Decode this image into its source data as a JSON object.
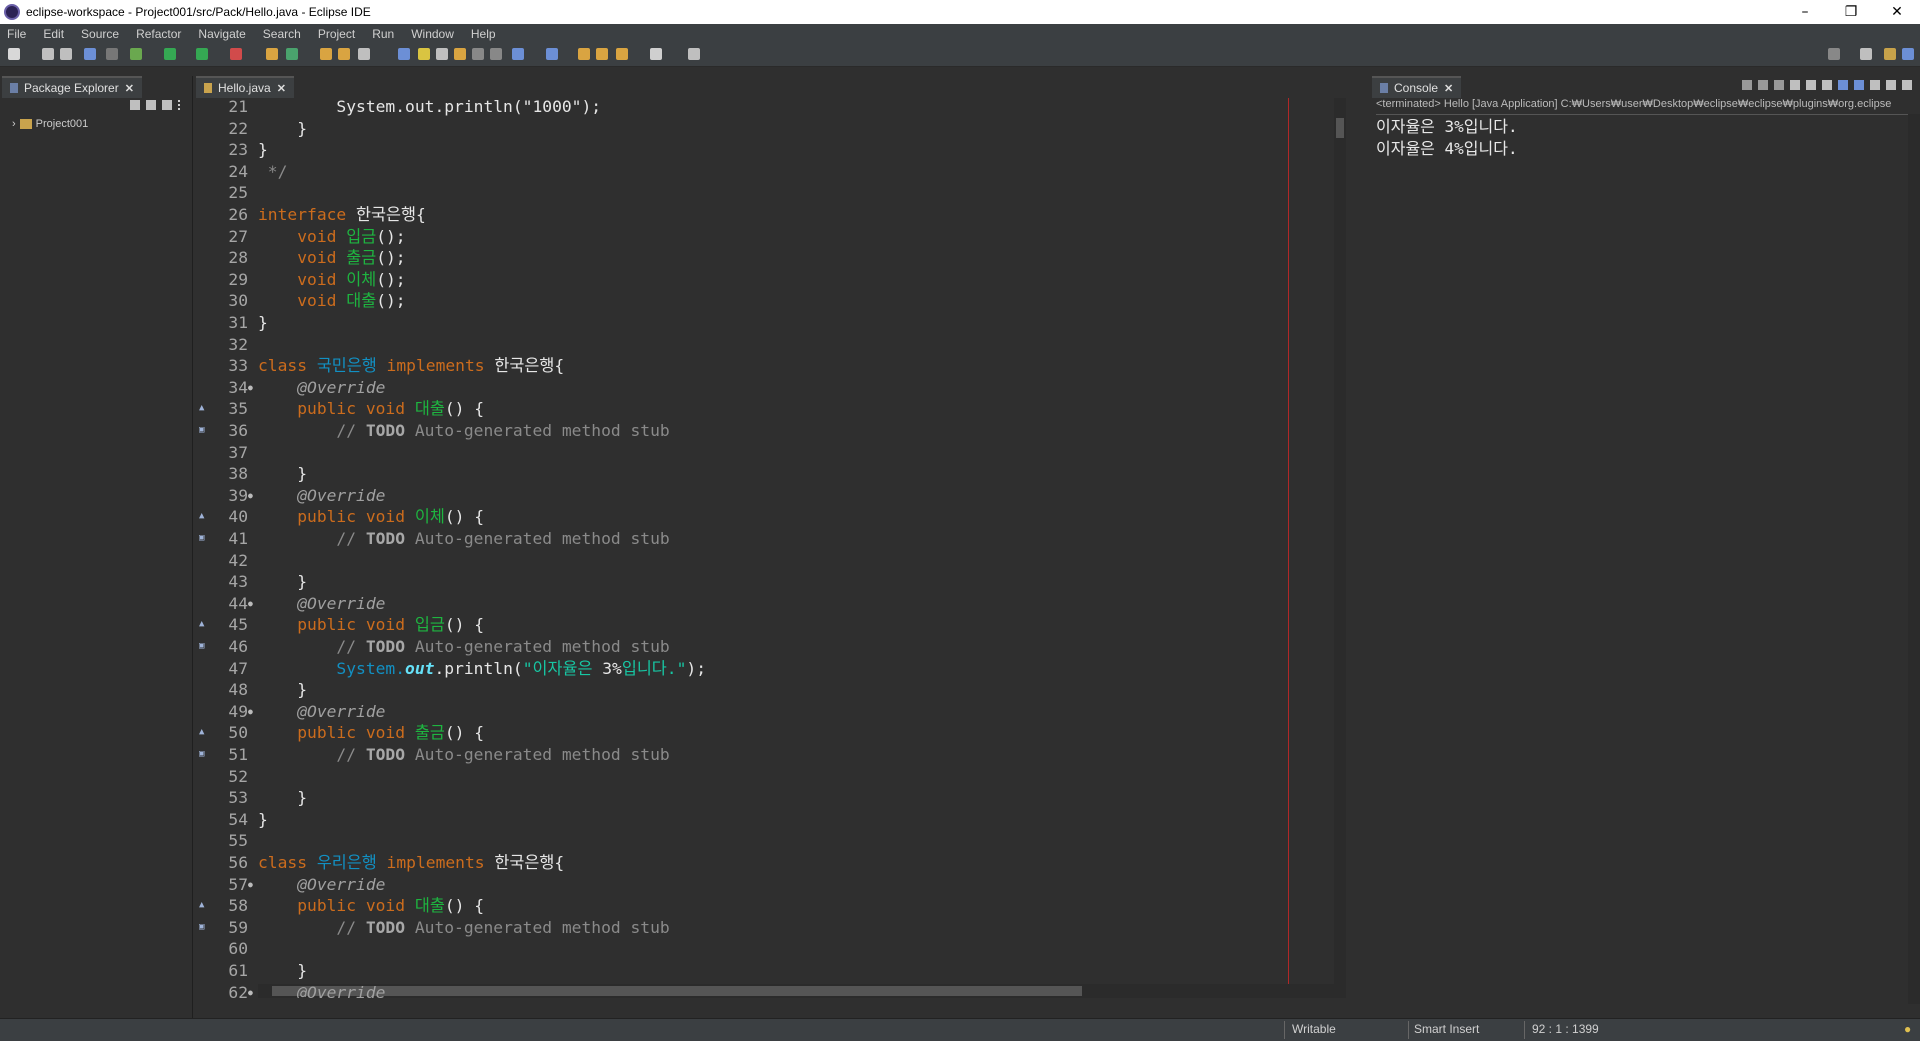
{
  "window": {
    "title": "eclipse-workspace - Project001/src/Pack/Hello.java - Eclipse IDE",
    "minimize": "–",
    "restore": "❐",
    "close": "✕"
  },
  "menu": [
    "File",
    "Edit",
    "Source",
    "Refactor",
    "Navigate",
    "Search",
    "Project",
    "Run",
    "Window",
    "Help"
  ],
  "package_explorer": {
    "tab_label": "Package Explorer",
    "close": "✕",
    "items": [
      {
        "label": "Project001",
        "expander": "›"
      }
    ]
  },
  "editor": {
    "tab_label": "Hello.java",
    "close": "✕",
    "lines": [
      {
        "n": "21",
        "tokens": [
          {
            "t": "        ",
            "c": "pl"
          },
          {
            "t": "System.out.println(\"1000\");",
            "c": "pl"
          }
        ]
      },
      {
        "n": "22",
        "tokens": [
          {
            "t": "    }",
            "c": "pl"
          }
        ]
      },
      {
        "n": "23",
        "tokens": [
          {
            "t": "}",
            "c": "pl"
          }
        ]
      },
      {
        "n": "24",
        "tokens": [
          {
            "t": " */",
            "c": "cm"
          }
        ]
      },
      {
        "n": "25",
        "tokens": []
      },
      {
        "n": "26",
        "tokens": [
          {
            "t": "interface ",
            "c": "kw"
          },
          {
            "t": "한국은행",
            "c": "pl"
          },
          {
            "t": "{",
            "c": "pl"
          }
        ]
      },
      {
        "n": "27",
        "tokens": [
          {
            "t": "    void ",
            "c": "kw"
          },
          {
            "t": "입금",
            "c": "mth"
          },
          {
            "t": "();",
            "c": "pl"
          }
        ]
      },
      {
        "n": "28",
        "tokens": [
          {
            "t": "    void ",
            "c": "kw"
          },
          {
            "t": "출금",
            "c": "mth"
          },
          {
            "t": "();",
            "c": "pl"
          }
        ]
      },
      {
        "n": "29",
        "tokens": [
          {
            "t": "    void ",
            "c": "kw"
          },
          {
            "t": "이체",
            "c": "mth"
          },
          {
            "t": "();",
            "c": "pl"
          }
        ]
      },
      {
        "n": "30",
        "tokens": [
          {
            "t": "    void ",
            "c": "kw"
          },
          {
            "t": "대출",
            "c": "mth"
          },
          {
            "t": "();",
            "c": "pl"
          }
        ]
      },
      {
        "n": "31",
        "tokens": [
          {
            "t": "}",
            "c": "pl"
          }
        ]
      },
      {
        "n": "32",
        "tokens": []
      },
      {
        "n": "33",
        "tokens": [
          {
            "t": "class ",
            "c": "kw"
          },
          {
            "t": "국민은행",
            "c": "cls"
          },
          {
            "t": " implements ",
            "c": "kw"
          },
          {
            "t": "한국은행",
            "c": "pl"
          },
          {
            "t": "{",
            "c": "pl"
          }
        ]
      },
      {
        "n": "34",
        "fold": "●",
        "tokens": [
          {
            "t": "    @Override",
            "c": "an"
          }
        ]
      },
      {
        "n": "35",
        "marker": "▲",
        "tokens": [
          {
            "t": "    public void ",
            "c": "kw"
          },
          {
            "t": "대출",
            "c": "mth"
          },
          {
            "t": "() {",
            "c": "pl"
          }
        ]
      },
      {
        "n": "36",
        "marker": "▣",
        "tokens": [
          {
            "t": "        // ",
            "c": "cm"
          },
          {
            "t": "TODO",
            "c": "todo"
          },
          {
            "t": " Auto-generated method stub",
            "c": "cm"
          }
        ]
      },
      {
        "n": "37",
        "tokens": []
      },
      {
        "n": "38",
        "tokens": [
          {
            "t": "    }",
            "c": "pl"
          }
        ]
      },
      {
        "n": "39",
        "fold": "●",
        "tokens": [
          {
            "t": "    @Override",
            "c": "an"
          }
        ]
      },
      {
        "n": "40",
        "marker": "▲",
        "tokens": [
          {
            "t": "    public void ",
            "c": "kw"
          },
          {
            "t": "이체",
            "c": "mth"
          },
          {
            "t": "() {",
            "c": "pl"
          }
        ]
      },
      {
        "n": "41",
        "marker": "▣",
        "tokens": [
          {
            "t": "        // ",
            "c": "cm"
          },
          {
            "t": "TODO",
            "c": "todo"
          },
          {
            "t": " Auto-generated method stub",
            "c": "cm"
          }
        ]
      },
      {
        "n": "42",
        "tokens": []
      },
      {
        "n": "43",
        "tokens": [
          {
            "t": "    }",
            "c": "pl"
          }
        ]
      },
      {
        "n": "44",
        "fold": "●",
        "tokens": [
          {
            "t": "    @Override",
            "c": "an"
          }
        ]
      },
      {
        "n": "45",
        "marker": "▲",
        "tokens": [
          {
            "t": "    public void ",
            "c": "kw"
          },
          {
            "t": "입금",
            "c": "mth"
          },
          {
            "t": "() {",
            "c": "pl"
          }
        ]
      },
      {
        "n": "46",
        "marker": "▣",
        "tokens": [
          {
            "t": "        // ",
            "c": "cm"
          },
          {
            "t": "TODO",
            "c": "todo"
          },
          {
            "t": " Auto-generated method stub",
            "c": "cm"
          }
        ]
      },
      {
        "n": "47",
        "tokens": [
          {
            "t": "        System.",
            "c": "cls"
          },
          {
            "t": "out",
            "c": "fld"
          },
          {
            "t": ".println(",
            "c": "pl"
          },
          {
            "t": "\"이자율은 ",
            "c": "str"
          },
          {
            "t": "3%",
            "c": "pl"
          },
          {
            "t": "입니다.\"",
            "c": "str"
          },
          {
            "t": ");",
            "c": "pl"
          }
        ]
      },
      {
        "n": "48",
        "tokens": [
          {
            "t": "    }",
            "c": "pl"
          }
        ]
      },
      {
        "n": "49",
        "fold": "●",
        "tokens": [
          {
            "t": "    @Override",
            "c": "an"
          }
        ]
      },
      {
        "n": "50",
        "marker": "▲",
        "tokens": [
          {
            "t": "    public void ",
            "c": "kw"
          },
          {
            "t": "출금",
            "c": "mth"
          },
          {
            "t": "() {",
            "c": "pl"
          }
        ]
      },
      {
        "n": "51",
        "marker": "▣",
        "tokens": [
          {
            "t": "        // ",
            "c": "cm"
          },
          {
            "t": "TODO",
            "c": "todo"
          },
          {
            "t": " Auto-generated method stub",
            "c": "cm"
          }
        ]
      },
      {
        "n": "52",
        "tokens": []
      },
      {
        "n": "53",
        "tokens": [
          {
            "t": "    }",
            "c": "pl"
          }
        ]
      },
      {
        "n": "54",
        "tokens": [
          {
            "t": "}",
            "c": "pl"
          }
        ]
      },
      {
        "n": "55",
        "tokens": []
      },
      {
        "n": "56",
        "tokens": [
          {
            "t": "class ",
            "c": "kw"
          },
          {
            "t": "우리은행",
            "c": "cls"
          },
          {
            "t": " implements ",
            "c": "kw"
          },
          {
            "t": "한국은행",
            "c": "pl"
          },
          {
            "t": "{",
            "c": "pl"
          }
        ]
      },
      {
        "n": "57",
        "fold": "●",
        "tokens": [
          {
            "t": "    @Override",
            "c": "an"
          }
        ]
      },
      {
        "n": "58",
        "marker": "▲",
        "tokens": [
          {
            "t": "    public void ",
            "c": "kw"
          },
          {
            "t": "대출",
            "c": "mth"
          },
          {
            "t": "() {",
            "c": "pl"
          }
        ]
      },
      {
        "n": "59",
        "marker": "▣",
        "tokens": [
          {
            "t": "        // ",
            "c": "cm"
          },
          {
            "t": "TODO",
            "c": "todo"
          },
          {
            "t": " Auto-generated method stub",
            "c": "cm"
          }
        ]
      },
      {
        "n": "60",
        "tokens": []
      },
      {
        "n": "61",
        "tokens": [
          {
            "t": "    }",
            "c": "pl"
          }
        ]
      },
      {
        "n": "62",
        "fold": "●",
        "tokens": [
          {
            "t": "    @Override",
            "c": "an"
          }
        ]
      }
    ]
  },
  "console": {
    "tab_label": "Console",
    "close": "✕",
    "path": "<terminated> Hello [Java Application] C:₩Users₩user₩Desktop₩eclipse₩eclipse₩plugins₩org.eclipse",
    "output": [
      "이자율은 3%입니다.",
      "이자율은 4%입니다."
    ]
  },
  "status": {
    "writable": "Writable",
    "insert_mode": "Smart Insert",
    "position": "92 : 1 : 1399"
  },
  "colors": {
    "keyword": "#cc6c1d",
    "method": "#1eb540",
    "class": "#1290c3",
    "string": "#17c6a3",
    "comment": "#8a8a8a",
    "background": "#2f2f2f"
  }
}
